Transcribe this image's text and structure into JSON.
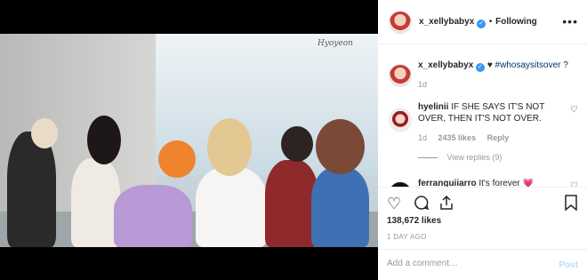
{
  "photo": {
    "watermark": "Hyoyeon"
  },
  "header": {
    "username": "x_xellybabyx",
    "verified_icon": "verified-badge-icon",
    "separator": "•",
    "follow_status": "Following",
    "more_icon": "more-options-icon"
  },
  "caption": {
    "username": "x_xellybabyx",
    "heart": "♥",
    "hashtag": "#whosaysitsover",
    "suffix": "?",
    "age": "1d"
  },
  "comments": [
    {
      "username": "hyelinii",
      "text": "IF SHE SAYS IT'S NOT OVER, THEN IT'S NOT OVER.",
      "age": "1d",
      "likes": "2435 likes",
      "reply_label": "Reply"
    },
    {
      "username": "ferranguiiarro",
      "text": "It's forever 💗"
    }
  ],
  "view_replies": "View replies (9)",
  "actions": {
    "like_icon": "heart-outline-icon",
    "comment_icon": "comment-bubble-icon",
    "share_icon": "share-icon",
    "save_icon": "bookmark-icon"
  },
  "likes": "138,672 likes",
  "date": "1 DAY AGO",
  "add_comment": {
    "placeholder": "Add a comment…",
    "post_label": "Post"
  },
  "colors": {
    "link": "#003569",
    "verified": "#3897f0",
    "post_disabled": "#b2dffc",
    "muted": "#999999"
  }
}
